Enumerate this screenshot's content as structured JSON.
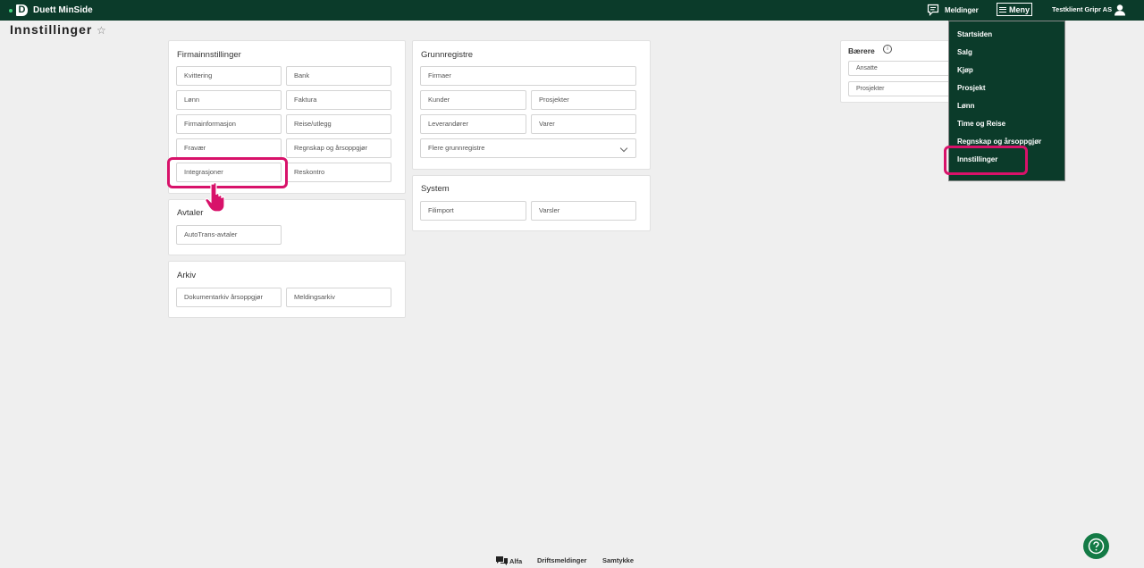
{
  "header": {
    "app_name": "Duett MinSide",
    "messages_label": "Meldinger",
    "menu_label": "Meny",
    "company_name": "Testklient Gripr AS"
  },
  "page": {
    "title": "Innstillinger"
  },
  "sections": {
    "firmainnstillinger": {
      "title": "Firmainnstillinger",
      "items": [
        "Kvittering",
        "Bank",
        "Lønn",
        "Faktura",
        "Firmainformasjon",
        "Reise/utlegg",
        "Fravær",
        "Regnskap og årsoppgjør",
        "Integrasjoner",
        "Reskontro"
      ]
    },
    "avtaler": {
      "title": "Avtaler",
      "items": [
        "AutoTrans-avtaler"
      ]
    },
    "arkiv": {
      "title": "Arkiv",
      "items": [
        "Dokumentarkiv årsoppgjør",
        "Meldingsarkiv"
      ]
    },
    "grunnregistre": {
      "title": "Grunnregistre",
      "items": [
        "Firmaer",
        "Kunder",
        "Prosjekter",
        "Leverandører",
        "Varer"
      ],
      "more_select": "Flere grunnregistre"
    },
    "system": {
      "title": "System",
      "items": [
        "Filimport",
        "Varsler"
      ]
    },
    "baerere": {
      "title": "Bærere",
      "items": [
        "Ansatte",
        "Prosjekter"
      ]
    }
  },
  "menu": {
    "items": [
      "Startsiden",
      "Salg",
      "Kjøp",
      "Prosjekt",
      "Lønn",
      "Time og Reise",
      "Regnskap og årsoppgjør",
      "Innstillinger"
    ]
  },
  "footer": {
    "links": [
      "Alfa",
      "Driftsmeldinger",
      "Samtykke"
    ]
  },
  "colors": {
    "header_bg": "#0b3b2a",
    "highlight": "#d8126a",
    "help_button": "#137a45"
  }
}
